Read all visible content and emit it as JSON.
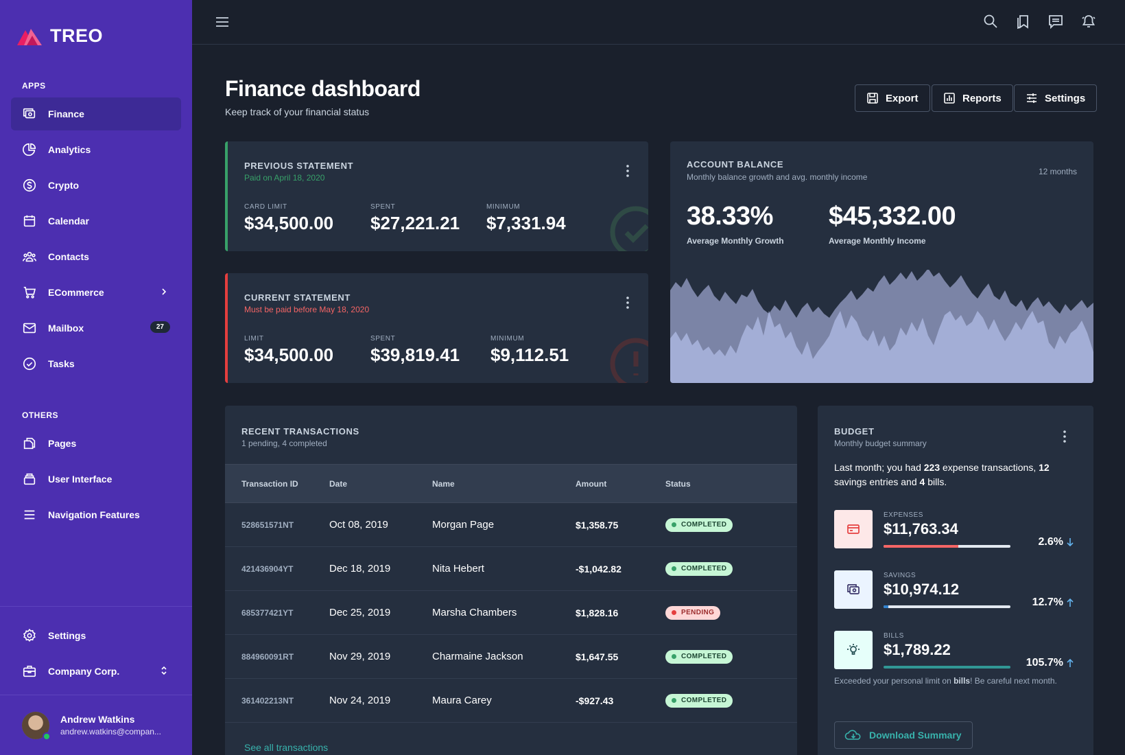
{
  "brand": {
    "name": "TREO",
    "accent": "#e91e63"
  },
  "sidebar": {
    "apps_label": "APPS",
    "others_label": "OTHERS",
    "apps": [
      {
        "label": "Finance",
        "icon": "finance-icon",
        "active": true
      },
      {
        "label": "Analytics",
        "icon": "pie-chart-icon"
      },
      {
        "label": "Crypto",
        "icon": "dollar-circle-icon"
      },
      {
        "label": "Calendar",
        "icon": "calendar-icon"
      },
      {
        "label": "Contacts",
        "icon": "contacts-icon"
      },
      {
        "label": "ECommerce",
        "icon": "cart-icon"
      },
      {
        "label": "Mailbox",
        "icon": "mail-icon",
        "badge": "27"
      },
      {
        "label": "Tasks",
        "icon": "check-circle-icon"
      }
    ],
    "others": [
      {
        "label": "Pages",
        "icon": "pages-icon"
      },
      {
        "label": "User Interface",
        "icon": "layers-icon"
      },
      {
        "label": "Navigation Features",
        "icon": "menu-icon"
      }
    ],
    "settings_label": "Settings",
    "company_label": "Company Corp.",
    "user": {
      "name": "Andrew Watkins",
      "email": "andrew.watkins@compan..."
    }
  },
  "header": {
    "title": "Finance dashboard",
    "subtitle": "Keep track of your financial status",
    "export_label": "Export",
    "reports_label": "Reports",
    "settings_label": "Settings"
  },
  "previous_statement": {
    "title": "PREVIOUS STATEMENT",
    "status": "Paid on April 18, 2020",
    "status_color": "#38a169",
    "card_limit_label": "CARD LIMIT",
    "card_limit": "$34,500.00",
    "spent_label": "SPENT",
    "spent": "$27,221.21",
    "minimum_label": "MINIMUM",
    "minimum": "$7,331.94"
  },
  "current_statement": {
    "title": "CURRENT STATEMENT",
    "status": "Must be paid before May 18, 2020",
    "status_color": "#f56565",
    "limit_label": "LIMIT",
    "limit": "$34,500.00",
    "spent_label": "SPENT",
    "spent": "$39,819.41",
    "minimum_label": "MINIMUM",
    "minimum": "$9,112.51"
  },
  "account_balance": {
    "title": "ACCOUNT BALANCE",
    "subtitle": "Monthly balance growth and avg. monthly income",
    "range": "12 months",
    "growth": "38.33%",
    "growth_label": "Average Monthly Growth",
    "income": "$45,332.00",
    "income_label": "Average Monthly Income"
  },
  "transactions": {
    "title": "RECENT TRANSACTIONS",
    "subtitle": "1 pending, 4 completed",
    "columns": [
      "Transaction ID",
      "Date",
      "Name",
      "Amount",
      "Status"
    ],
    "rows": [
      {
        "id": "528651571NT",
        "date": "Oct 08, 2019",
        "name": "Morgan Page",
        "amount": "$1,358.75",
        "status": "COMPLETED"
      },
      {
        "id": "421436904YT",
        "date": "Dec 18, 2019",
        "name": "Nita Hebert",
        "amount": "-$1,042.82",
        "status": "COMPLETED"
      },
      {
        "id": "685377421YT",
        "date": "Dec 25, 2019",
        "name": "Marsha Chambers",
        "amount": "$1,828.16",
        "status": "PENDING"
      },
      {
        "id": "884960091RT",
        "date": "Nov 29, 2019",
        "name": "Charmaine Jackson",
        "amount": "$1,647.55",
        "status": "COMPLETED"
      },
      {
        "id": "361402213NT",
        "date": "Nov 24, 2019",
        "name": "Maura Carey",
        "amount": "-$927.43",
        "status": "COMPLETED"
      }
    ],
    "see_all": "See all transactions"
  },
  "budget": {
    "title": "BUDGET",
    "subtitle": "Monthly budget summary",
    "summary_prefix": "Last month; you had ",
    "expense_count": "223",
    "summary_mid1": " expense transactions, ",
    "savings_count": "12",
    "summary_mid2": " savings entries and ",
    "bills_count": "4",
    "summary_suffix": " bills.",
    "items": [
      {
        "label": "EXPENSES",
        "value": "$11,763.34",
        "percent": "2.6%",
        "trend": "down",
        "fill": 0.59,
        "bar_color": "#f56565",
        "icon_bg": "#fde8e8",
        "icon_color": "#e53e3e",
        "arrow_color": "#63b3ed"
      },
      {
        "label": "SAVINGS",
        "value": "$10,974.12",
        "percent": "12.7%",
        "trend": "up",
        "fill": 0.04,
        "bar_color": "#3182ce",
        "icon_bg": "#ebf4ff",
        "icon_color": "#3c366b",
        "arrow_color": "#63b3ed"
      },
      {
        "label": "BILLS",
        "value": "$1,789.22",
        "percent": "105.7%",
        "trend": "up",
        "fill": 1.0,
        "bar_color": "#319795",
        "icon_bg": "#e6fffa",
        "icon_color": "#234e52",
        "arrow_color": "#63b3ed"
      }
    ],
    "note_prefix": "Exceeded your personal limit on ",
    "note_bold": "bills",
    "note_suffix": "! Be careful next month.",
    "download_label": "Download Summary"
  }
}
